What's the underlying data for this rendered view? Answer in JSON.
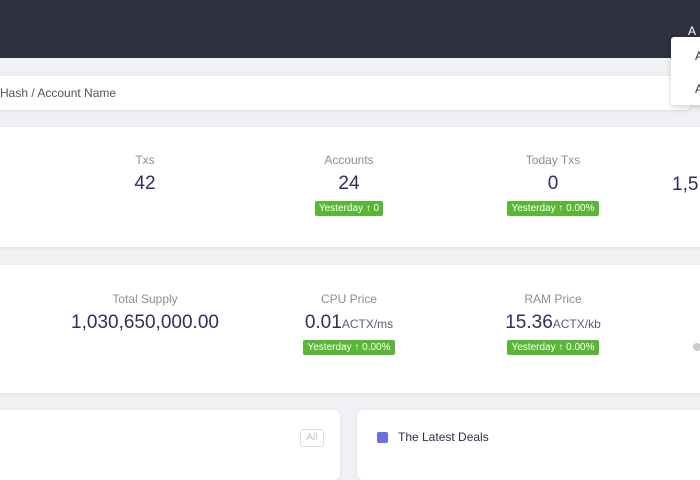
{
  "topbar": {
    "menu_label": "A"
  },
  "search": {
    "placeholder": "Hash / Account Name"
  },
  "dropdown": {
    "items": [
      "A",
      "A"
    ]
  },
  "stats_row1": [
    {
      "label": "Txs",
      "value": "42"
    },
    {
      "label": "Accounts",
      "value": "24",
      "badge": "Yesterday ↑ 0"
    },
    {
      "label": "Today Txs",
      "value": "0",
      "badge": "Yesterday ↑ 0.00%"
    },
    {
      "label": "",
      "value": "1,5"
    }
  ],
  "stats_row2": [
    {
      "label": "Total Supply",
      "value": "1,030,650,000.00"
    },
    {
      "label": "CPU Price",
      "value": "0.01",
      "unit": "ACTX/ms",
      "badge": "Yesterday ↑ 0.00%"
    },
    {
      "label": "RAM Price",
      "value": "15.36",
      "unit": "ACTX/kb",
      "badge": "Yesterday ↑ 0.00%"
    }
  ],
  "panels": {
    "all_label": "All",
    "deals_title": "The Latest Deals"
  },
  "colors": {
    "topbar": "#2d3140",
    "badge": "#58b734",
    "value_text": "#2b3060",
    "deals_icon": "#6a6fe3"
  }
}
